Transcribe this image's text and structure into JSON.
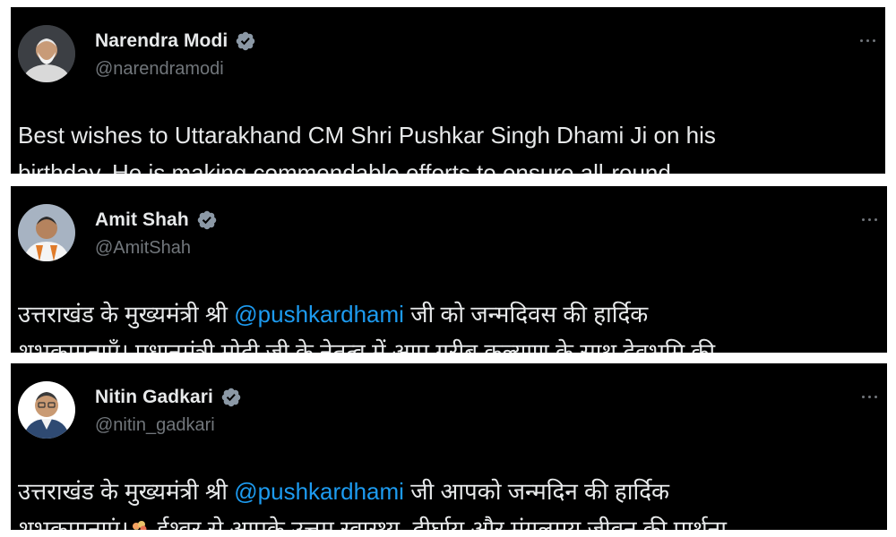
{
  "tweets": [
    {
      "display_name": "Narendra Modi",
      "handle": "@narendramodi",
      "verified": true,
      "text_line_1": "Best wishes to Uttarakhand CM Shri Pushkar Singh Dhami Ji on his",
      "text_line_2": "birthday. He is making commendable efforts to ensure all-round"
    },
    {
      "display_name": "Amit Shah",
      "handle": "@AmitShah",
      "verified": true,
      "text_line_1_before": "उत्तराखंड के मुख्यमंत्री श्री ",
      "mention": "@pushkardhami",
      "text_line_1_after": " जी को जन्मदिवस की हार्दिक",
      "text_line_2": "शुभकामनाएँ। प्रधानमंत्री मोदी जी के नेतृत्व में आप गरीब कल्याण के साथ देवभूमि की"
    },
    {
      "display_name": "Nitin Gadkari",
      "handle": "@nitin_gadkari",
      "verified": true,
      "text_line_1_before": "उत्तराखंड के मुख्यमंत्री श्री ",
      "mention": "@pushkardhami",
      "text_line_1_after": " जी आपको जन्मदिन की हार्दिक",
      "text_line_2_before_emoji": "शुभकामनाएं।",
      "text_line_2_emoji": "bouquet-emoji",
      "text_line_2_after_emoji": "ईश्वर से आपके उत्तम स्वास्थ्य, दीर्घायु और मंगलमय जीवन की प्रार्थना"
    }
  ],
  "colors": {
    "card_bg": "#000000",
    "text": "#e7e9ea",
    "secondary": "#71767b",
    "mention": "#1d9bf0",
    "verified_badge": "#8b98a5"
  },
  "icons": {
    "verified": "verified-badge-icon",
    "more": "more-options-icon",
    "avatar": "avatar"
  }
}
